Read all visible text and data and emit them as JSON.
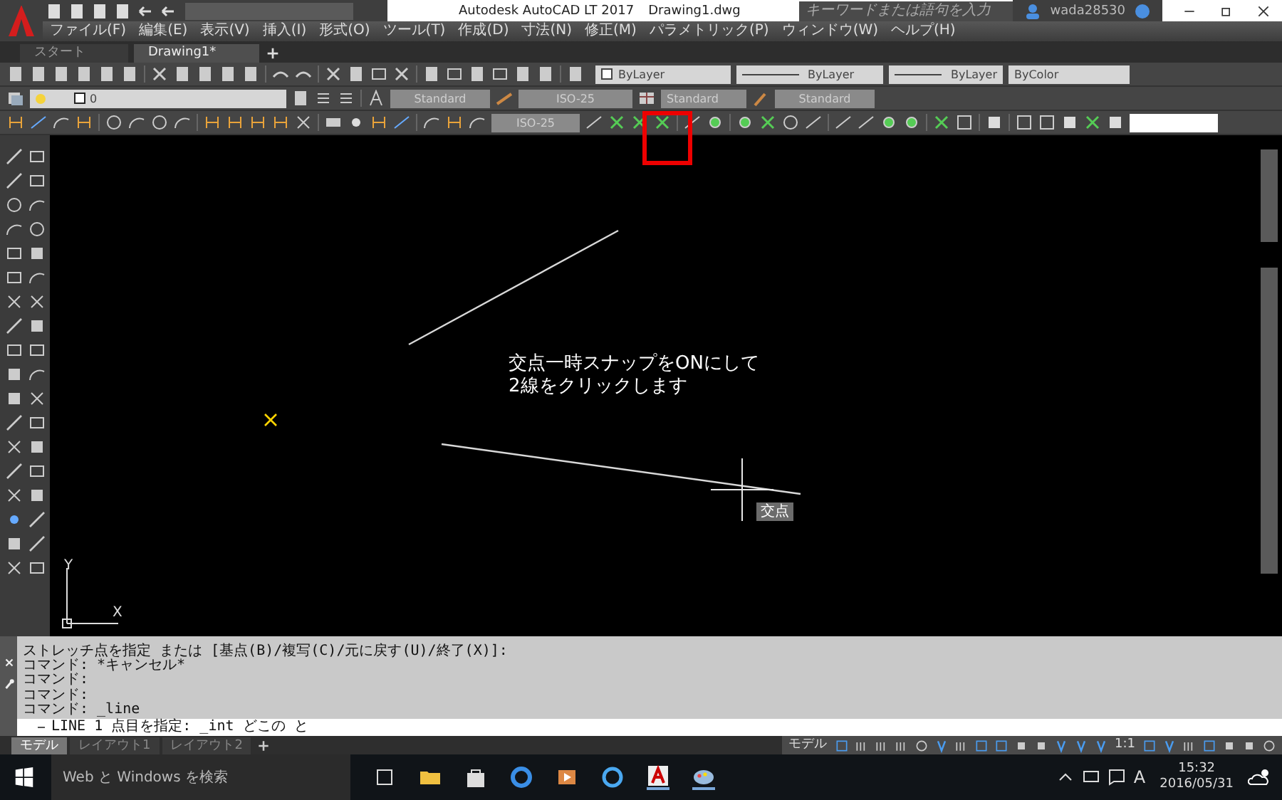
{
  "title_bar": {
    "app": "Autodesk AutoCAD LT 2017",
    "document": "Drawing1.dwg",
    "search": {
      "placeholder": "キーワードまたは語句を入力"
    },
    "user": "wada28530"
  },
  "menu": [
    "ファイル(F)",
    "編集(E)",
    "表示(V)",
    "挿入(I)",
    "形式(O)",
    "ツール(T)",
    "作成(D)",
    "寸法(N)",
    "修正(M)",
    "パラメトリック(P)",
    "ウィンドウ(W)",
    "ヘルプ(H)"
  ],
  "doc_tabs": [
    {
      "label": "スタート",
      "selected": false
    },
    {
      "label": "Drawing1*",
      "selected": true
    }
  ],
  "toolbars": {
    "color_property": "ByLayer",
    "linetype": "ByLayer",
    "lineweight": "ByLayer",
    "plot_style": "ByColor",
    "layer": "0",
    "text_style": "Standard",
    "dim_style": "ISO-25",
    "table_style": "Standard",
    "multileader_style": "Standard",
    "dim_style_current": "ISO-25"
  },
  "canvas": {
    "annotation": [
      "交点一時スナップをONにして",
      "2線をクリックします"
    ],
    "snap_tooltip": "交点",
    "ucs": {
      "x": "X",
      "y": "Y"
    }
  },
  "command": {
    "history": [
      "ストレッチ点を指定 または [基点(B)/複写(C)/元に戻す(U)/終了(X)]:",
      "コマンド: *キャンセル*",
      "コマンド:",
      "コマンド:",
      "コマンド: _line"
    ],
    "input": "LINE 1 点目を指定: _int どこの  と"
  },
  "layout_tabs": [
    {
      "label": "モデル",
      "selected": true
    },
    {
      "label": "レイアウト1",
      "selected": false
    },
    {
      "label": "レイアウト2",
      "selected": false
    }
  ],
  "status_bar": {
    "space": "モデル",
    "scale": "1:1"
  },
  "taskbar": {
    "search": {
      "placeholder": "Web と Windows を検索"
    },
    "ime": "A",
    "time": "15:32",
    "date": "2016/05/31"
  }
}
